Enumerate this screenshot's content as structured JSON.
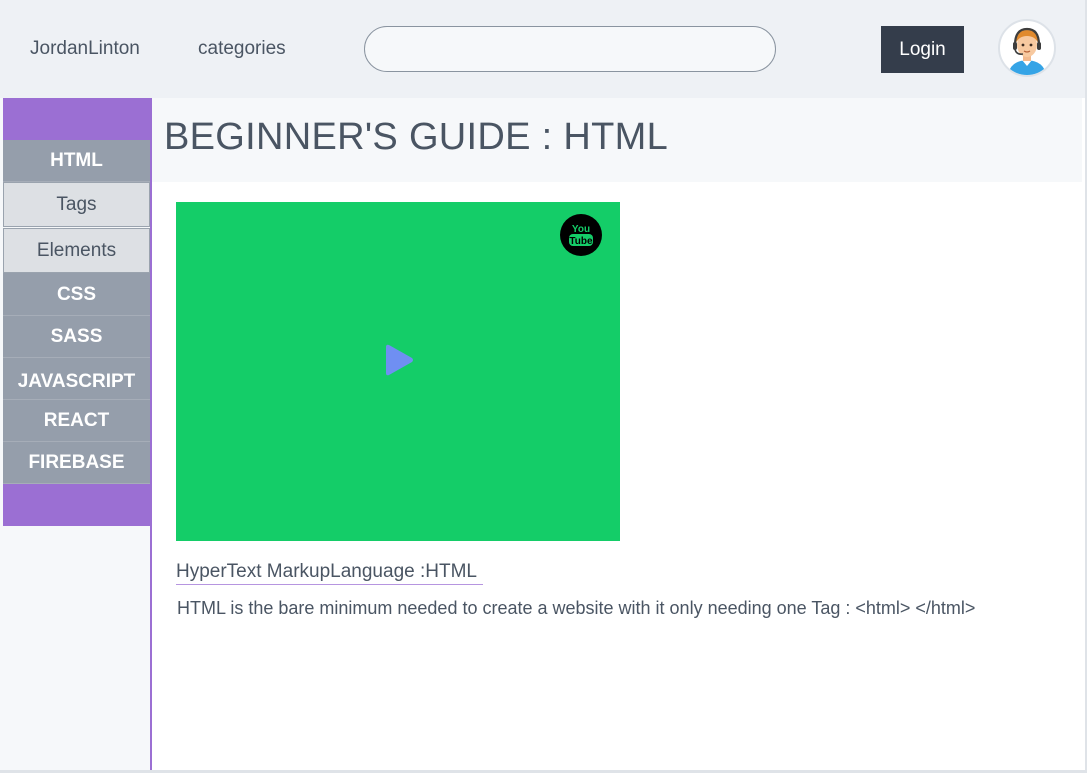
{
  "header": {
    "brand": "JordanLinton",
    "nav_categories": "categories",
    "search_placeholder": "",
    "search_value": "",
    "login_label": "Login",
    "avatar_icon": "support-agent-avatar-icon"
  },
  "sidebar": {
    "accent_color": "#9b6fd3",
    "items": [
      {
        "label": "HTML",
        "kind": "section"
      },
      {
        "label": "Tags",
        "kind": "sub"
      },
      {
        "label": "Elements",
        "kind": "sub"
      },
      {
        "label": "CSS",
        "kind": "section"
      },
      {
        "label": "SASS",
        "kind": "section"
      },
      {
        "label": "JAVASCRIPT",
        "kind": "section"
      },
      {
        "label": "REACT",
        "kind": "section"
      },
      {
        "label": "FIREBASE",
        "kind": "section"
      }
    ]
  },
  "main": {
    "title": "BEGINNER'S GUIDE : HTML",
    "video": {
      "background_color": "#14cd68",
      "badge_icon": "youtube-icon",
      "play_icon": "play-icon"
    },
    "caption": "HyperText MarkupLanguage :HTML",
    "description": "HTML is the bare minimum needed to create a website with it only needing one Tag : <html> </html>"
  }
}
